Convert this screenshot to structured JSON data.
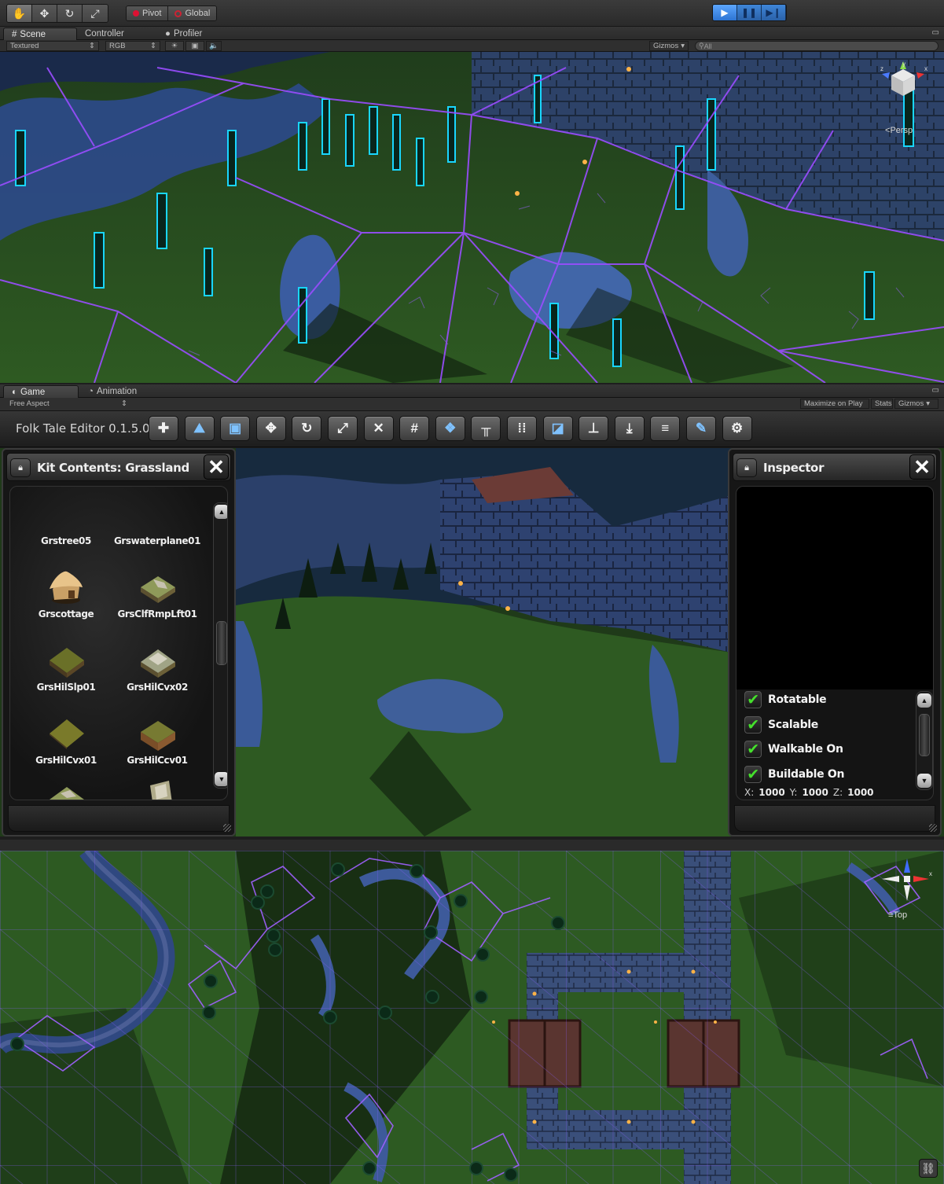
{
  "toolbar": {
    "tools": [
      {
        "icon": "hand-icon",
        "glyph": "✋"
      },
      {
        "icon": "move-icon",
        "glyph": "✥"
      },
      {
        "icon": "rotate-icon",
        "glyph": "↻"
      },
      {
        "icon": "scale-icon",
        "glyph": "⤢"
      }
    ],
    "pivot_label": "Pivot",
    "global_label": "Global",
    "play_icon": "▶",
    "pause_icon": "❚❚",
    "step_icon": "▶❙"
  },
  "scene_tabs": {
    "scene": "Scene",
    "controller": "Controller",
    "profiler": "Profiler"
  },
  "scene_bar": {
    "render_mode": "Textured",
    "color_mode": "RGB",
    "gizmos": "Gizmos",
    "search_placeholder": "All"
  },
  "scene_view": {
    "projection": "Persp"
  },
  "game_tabs": {
    "game": "Game",
    "animation": "Animation"
  },
  "game_bar": {
    "aspect": "Free Aspect",
    "maximize": "Maximize on Play",
    "stats": "Stats",
    "gizmos": "Gizmos"
  },
  "editor": {
    "title": "Folk Tale Editor 0.1.5.0",
    "buttons": [
      {
        "name": "new-button",
        "glyph": "✚",
        "blue": false
      },
      {
        "name": "open-button",
        "glyph": "⛰",
        "blue": true
      },
      {
        "name": "save-button",
        "glyph": "▣",
        "blue": true
      },
      {
        "name": "move-button",
        "glyph": "✥",
        "blue": false
      },
      {
        "name": "rotate-button",
        "glyph": "↻",
        "blue": false
      },
      {
        "name": "scale-button",
        "glyph": "⤢",
        "blue": false
      },
      {
        "name": "delete-button",
        "glyph": "✕",
        "blue": false
      },
      {
        "name": "grid-button",
        "glyph": "#",
        "blue": false
      },
      {
        "name": "kit-button",
        "glyph": "❖",
        "blue": true
      },
      {
        "name": "align-top-button",
        "glyph": "╥",
        "blue": false
      },
      {
        "name": "snap-grid-button",
        "glyph": "⁞⁞",
        "blue": false
      },
      {
        "name": "stack-button",
        "glyph": "◪",
        "blue": true
      },
      {
        "name": "hierarchy-button",
        "glyph": "⊥",
        "blue": false
      },
      {
        "name": "drop-button",
        "glyph": "⤓",
        "blue": false
      },
      {
        "name": "layers-button",
        "glyph": "≡",
        "blue": false
      },
      {
        "name": "paint-button",
        "glyph": "✎",
        "blue": true
      },
      {
        "name": "settings-button",
        "glyph": "⚙",
        "blue": false
      }
    ]
  },
  "kit_panel": {
    "title": "Kit Contents: Grassland",
    "items": [
      {
        "label": "Grstree05"
      },
      {
        "label": "Grswaterplane01"
      },
      {
        "label": "Grscottage"
      },
      {
        "label": "GrsClfRmpLft01"
      },
      {
        "label": "GrsHilSlp01"
      },
      {
        "label": "GrsHilCvx02"
      },
      {
        "label": "GrsHilCvx01"
      },
      {
        "label": "GrsHilCcv01"
      }
    ]
  },
  "inspector": {
    "title": "Inspector",
    "options": [
      {
        "label": "Rotatable",
        "checked": true
      },
      {
        "label": "Scalable",
        "checked": true
      },
      {
        "label": "Walkable On",
        "checked": true
      },
      {
        "label": "Buildable On",
        "checked": true
      }
    ],
    "scale": {
      "x_label": "X:",
      "x": "1000",
      "y_label": "Y:",
      "y": "1000",
      "z_label": "Z:",
      "z": "1000"
    }
  },
  "top_view": {
    "projection": "Top"
  },
  "colors": {
    "navmesh": "#9a4dff",
    "grass": "#2f5a22",
    "stone": "#3f5f9a",
    "tree_outline": "#19d6ff",
    "check": "#45e02c"
  }
}
